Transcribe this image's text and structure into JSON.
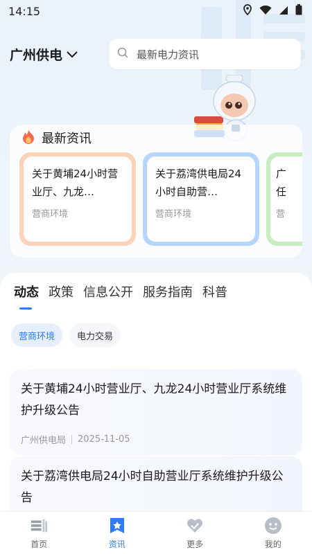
{
  "status_bar": {
    "time": "14:15"
  },
  "header": {
    "city": "广州供电",
    "search_placeholder": "最新电力资讯"
  },
  "news_panel": {
    "title": "最新资讯",
    "cards": [
      {
        "title": "关于黄埔24小时营业厅、九龙…",
        "tag": "营商环境",
        "border": "#fbd3b8"
      },
      {
        "title": "关于荔湾供电局24小时自助营…",
        "tag": "营商环境",
        "border": "#b7d4fb"
      },
      {
        "title": "广任",
        "tag": "营",
        "border": "#c6ecc0"
      }
    ]
  },
  "tabs": [
    {
      "label": "动态",
      "active": true
    },
    {
      "label": "政策",
      "active": false
    },
    {
      "label": "信息公开",
      "active": false
    },
    {
      "label": "服务指南",
      "active": false
    },
    {
      "label": "科普",
      "active": false
    }
  ],
  "chips": [
    {
      "label": "营商环境",
      "active": true
    },
    {
      "label": "电力交易",
      "active": false
    }
  ],
  "articles": [
    {
      "title": "关于黄埔24小时营业厅、九龙24小时营业厅系统维护升级公告",
      "source": "广州供电局",
      "date": "2025-11-05"
    },
    {
      "title": "关于荔湾供电局24小时自助营业厅系统维护升级公告",
      "source": "",
      "date": ""
    }
  ],
  "bottom_nav": [
    {
      "label": "首页",
      "icon": "home-icon",
      "active": false
    },
    {
      "label": "资讯",
      "icon": "news-icon",
      "active": true
    },
    {
      "label": "更多",
      "icon": "more-icon",
      "active": false
    },
    {
      "label": "我的",
      "icon": "profile-icon",
      "active": false
    }
  ],
  "colors": {
    "accent": "#2f7cf6"
  }
}
